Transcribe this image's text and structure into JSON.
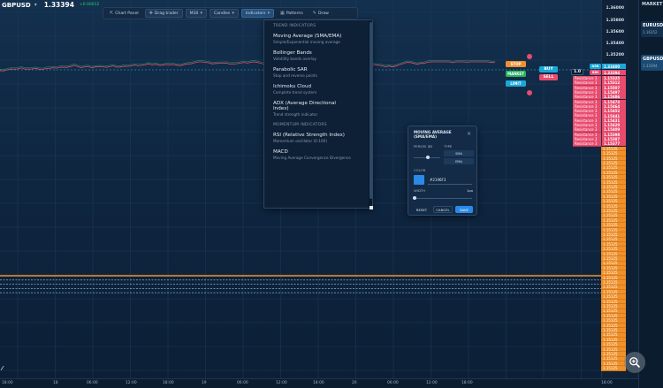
{
  "header": {
    "symbol": "GBPUSD",
    "price": "1.33394",
    "change": "+0.00012"
  },
  "toolbar": {
    "chart_panel": "Chart Panel",
    "drag_trader": "Drag trader",
    "timeframe": "M30",
    "chart_type": "Candles",
    "indicators": "Indicators",
    "patterns": "Patterns",
    "draw": "Draw"
  },
  "indicator_menu": {
    "trend_header": "TREND INDICATORS",
    "momentum_header": "MOMENTUM INDICATORS",
    "trend_items": [
      {
        "name": "Moving Average (SMA/EMA)",
        "desc": "Simple/Exponential moving average"
      },
      {
        "name": "Bollinger Bands",
        "desc": "Volatility bands overlay"
      },
      {
        "name": "Parabolic SAR",
        "desc": "Stop and reverse points"
      },
      {
        "name": "Ichimoku Cloud",
        "desc": "Complete trend system"
      },
      {
        "name": "ADX (Average Directional Index)",
        "desc": "Trend strength indicator"
      }
    ],
    "momentum_items": [
      {
        "name": "RSI (Relative Strength Index)",
        "desc": "Momentum oscillator (0-100)"
      },
      {
        "name": "MACD",
        "desc": "Moving Average Convergence Divergence"
      }
    ]
  },
  "ma_dialog": {
    "title": "MOVING AVERAGE (SMA/EMA)",
    "period_label": "PERIOD",
    "period_value": "20",
    "type_label": "TYPE",
    "options": [
      "SMA",
      "EMA"
    ],
    "color_label": "COLOR",
    "color_value": "#2196F3",
    "color_hex": "#2b8ae8",
    "width_label": "WIDTH",
    "width_value": "1px",
    "reset_label": "RESET",
    "cancel_label": "CANCEL",
    "save_label": "SAVE"
  },
  "trade": {
    "stop_label": "STOP",
    "market_label": "MARKET",
    "limit_label": "LIMIT",
    "buy_label": "BUY",
    "sell_label": "SELL",
    "sell_small_label": "SELL",
    "qty_label": "1.0",
    "ask_label": "ASK",
    "bid_label": "BID"
  },
  "price_scale": {
    "labels": [
      "1.36000",
      "1.35800",
      "1.35600",
      "1.35400",
      "1.35200",
      "1.35000"
    ],
    "ask_tag": "1.33400",
    "bid_tag": "1.33394"
  },
  "resistance": {
    "label": "Resistance 3",
    "prices": [
      "1.15325",
      "1.15312",
      "1.15507",
      "1.15497",
      "1.15486",
      "1.15474",
      "1.15464",
      "1.15452",
      "1.15441",
      "1.15431",
      "1.15420",
      "1.15409",
      "1.15398",
      "1.15387",
      "1.15377"
    ]
  },
  "orange_tags": {
    "value": "1.15125",
    "count": 47
  },
  "right_panel": {
    "title": "MARKET",
    "items": [
      {
        "symbol": "EURUSD",
        "value": "1.16352"
      },
      {
        "symbol": "GBPUSD",
        "value": "1.33394"
      }
    ]
  },
  "time_scale": [
    "18:00",
    "18",
    "06:00",
    "12:00",
    "18:00",
    "19",
    "06:00",
    "12:00",
    "18:00",
    "20",
    "06:00",
    "12:00",
    "18:00",
    "18:00"
  ],
  "colors": {
    "accent": "#2b8ae8",
    "buy": "#1ba7d9",
    "sell": "#e84b6e",
    "stop": "#f0902a",
    "market": "#27b35d",
    "orange_line": "#f0902a"
  }
}
